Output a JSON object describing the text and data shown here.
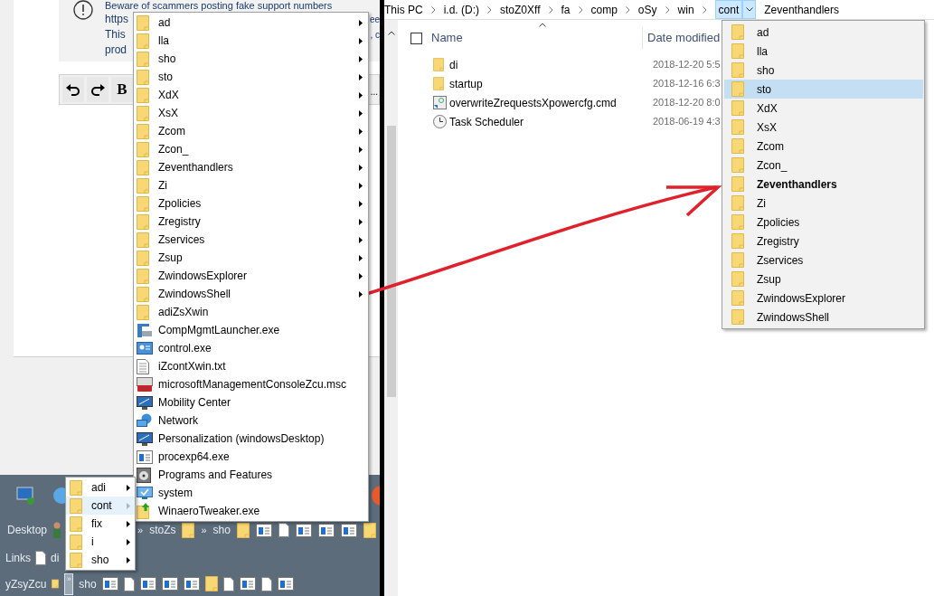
{
  "notice": {
    "lines": [
      {
        "left": "Beware of scammers posting fake support numbers"
      },
      {
        "left": "https",
        "right": "ee"
      },
      {
        "left": "This",
        "right": ", c"
      },
      {
        "left": "prod"
      }
    ]
  },
  "editor_toolbar": {
    "bold": "B",
    "overflow": "..."
  },
  "taskbar": {
    "rows": [
      {
        "label": "Desktop",
        "links": [
          {
            "chevron": "»",
            "text": "stoZs"
          },
          {
            "chevron": "»",
            "text": "sho"
          }
        ]
      },
      {
        "label": "Links",
        "links": [
          {
            "text": "di"
          }
        ]
      },
      {
        "label": "yZsyZcu",
        "chevron_button": {
          "text": "»",
          "pressed": true
        },
        "links": [
          {
            "text": "sho"
          }
        ]
      }
    ]
  },
  "explorer": {
    "breadcrumb": [
      {
        "label": "This PC",
        "selected": false
      },
      {
        "label": "i.d. (D:)",
        "selected": false
      },
      {
        "label": "stoZ0Xff",
        "selected": false
      },
      {
        "label": "fa",
        "selected": false
      },
      {
        "label": "comp",
        "selected": false
      },
      {
        "label": "oSy",
        "selected": false
      },
      {
        "label": "win",
        "selected": false
      },
      {
        "label": "cont",
        "selected": true
      }
    ],
    "breadcrumb_next": "Zeventhandlers",
    "columns": [
      "Name",
      "Date modified"
    ],
    "select_all": {
      "checked": false
    },
    "files": [
      {
        "name": "di",
        "date": "2018-12-20 5:5",
        "kind": "folder"
      },
      {
        "name": "startup",
        "date": "2018-12-16 6:3",
        "kind": "folder"
      },
      {
        "name": "overwriteZrequestsXpowercfg.cmd",
        "date": "2018-12-20 8:0",
        "kind": "script"
      },
      {
        "name": "Task Scheduler",
        "date": "2018-06-19 4:3",
        "kind": "clock"
      }
    ]
  },
  "context_menu": {
    "items": [
      {
        "label": "ad",
        "kind": "folder",
        "submenu": true
      },
      {
        "label": "lla",
        "kind": "folder",
        "submenu": true
      },
      {
        "label": "sho",
        "kind": "folder",
        "submenu": true
      },
      {
        "label": "sto",
        "kind": "folder",
        "submenu": true
      },
      {
        "label": "XdX",
        "kind": "folder",
        "submenu": true
      },
      {
        "label": "XsX",
        "kind": "folder",
        "submenu": true
      },
      {
        "label": "Zcom",
        "kind": "folder",
        "submenu": true
      },
      {
        "label": "Zcon_",
        "kind": "folder",
        "submenu": true
      },
      {
        "label": "Zeventhandlers",
        "kind": "folder",
        "submenu": true
      },
      {
        "label": "Zi",
        "kind": "folder",
        "submenu": true
      },
      {
        "label": "Zpolicies",
        "kind": "folder",
        "submenu": true
      },
      {
        "label": "Zregistry",
        "kind": "folder",
        "submenu": true
      },
      {
        "label": "Zservices",
        "kind": "folder",
        "submenu": true
      },
      {
        "label": "Zsup",
        "kind": "folder",
        "submenu": true
      },
      {
        "label": "ZwindowsExplorer",
        "kind": "folder",
        "submenu": true
      },
      {
        "label": "ZwindowsShell",
        "kind": "folder",
        "submenu": true
      },
      {
        "label": "adiZsXwin",
        "kind": "folder",
        "submenu": false
      },
      {
        "label": "CompMgmtLauncher.exe",
        "kind": "tool",
        "submenu": false
      },
      {
        "label": "control.exe",
        "kind": "panel",
        "submenu": false
      },
      {
        "label": "iZcontXwin.txt",
        "kind": "text",
        "submenu": false
      },
      {
        "label": "microsoftManagementConsoleZcu.msc",
        "kind": "toolbox",
        "submenu": false
      },
      {
        "label": "Mobility Center",
        "kind": "monitor",
        "submenu": false
      },
      {
        "label": "Network",
        "kind": "network",
        "submenu": false
      },
      {
        "label": "Personalization (windowsDesktop)",
        "kind": "monitor",
        "submenu": false
      },
      {
        "label": "procexp64.exe",
        "kind": "window",
        "submenu": false
      },
      {
        "label": "Programs and Features",
        "kind": "disc",
        "submenu": false
      },
      {
        "label": "system",
        "kind": "check",
        "submenu": false
      },
      {
        "label": "WinaeroTweaker.exe",
        "kind": "installer",
        "submenu": false
      }
    ]
  },
  "sub_menu": {
    "items": [
      {
        "label": "adi",
        "selected": false
      },
      {
        "label": "cont",
        "selected": true
      },
      {
        "label": "fix",
        "selected": false
      },
      {
        "label": "i",
        "selected": false
      },
      {
        "label": "sho",
        "selected": false
      }
    ]
  },
  "dropdown": {
    "items": [
      {
        "label": "ad",
        "selected": false,
        "current": false
      },
      {
        "label": "lla",
        "selected": false,
        "current": false
      },
      {
        "label": "sho",
        "selected": false,
        "current": false
      },
      {
        "label": "sto",
        "selected": true,
        "current": false
      },
      {
        "label": "XdX",
        "selected": false,
        "current": false
      },
      {
        "label": "XsX",
        "selected": false,
        "current": false
      },
      {
        "label": "Zcom",
        "selected": false,
        "current": false
      },
      {
        "label": "Zcon_",
        "selected": false,
        "current": false
      },
      {
        "label": "Zeventhandlers",
        "selected": false,
        "current": true
      },
      {
        "label": "Zi",
        "selected": false,
        "current": false
      },
      {
        "label": "Zpolicies",
        "selected": false,
        "current": false
      },
      {
        "label": "Zregistry",
        "selected": false,
        "current": false
      },
      {
        "label": "Zservices",
        "selected": false,
        "current": false
      },
      {
        "label": "Zsup",
        "selected": false,
        "current": false
      },
      {
        "label": "ZwindowsExplorer",
        "selected": false,
        "current": false
      },
      {
        "label": "ZwindowsShell",
        "selected": false,
        "current": false
      }
    ]
  }
}
